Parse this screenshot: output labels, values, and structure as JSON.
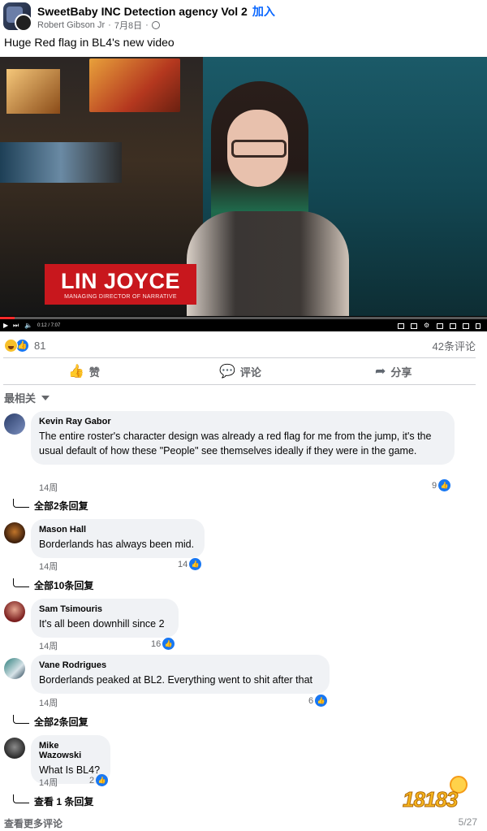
{
  "post": {
    "group_name": "SweetBaby INC Detection agency Vol 2",
    "join_label": "加入",
    "author": "Robert Gibson Jr",
    "date": "7月8日",
    "text": "Huge Red flag in BL4's new video"
  },
  "video": {
    "name_plate": "LIN JOYCE",
    "name_subtitle": "MANAGING DIRECTOR OF NARRATIVE",
    "time": "0:12 / 7:07",
    "progress": 0.03,
    "colors": {
      "progress": "#ff2a2a",
      "plate": "#c8171d"
    }
  },
  "stats": {
    "reaction_count": "81",
    "comment_count": "42条评论"
  },
  "actions": {
    "like": "赞",
    "comment": "评论",
    "share": "分享"
  },
  "sort_label": "最相关",
  "comments": [
    {
      "name": "Kevin Ray Gabor",
      "text": "The entire roster's character design was already a red flag for me from the jump, it's the usual default of how these \"People\" see themselves ideally if they were in the game.",
      "time": "14周",
      "likes": "9",
      "replies": "全部2条回复"
    },
    {
      "name": "Mason Hall",
      "text": "Borderlands has always been mid.",
      "time": "14周",
      "likes": "14",
      "replies": "全部10条回复"
    },
    {
      "name": "Sam Tsimouris",
      "text": "It's all been downhill since 2",
      "time": "14周",
      "likes": "16",
      "replies": ""
    },
    {
      "name": "Vane Rodrigues",
      "text": "Borderlands peaked at BL2. Everything went to shit after that",
      "time": "14周",
      "likes": "6",
      "replies": "全部2条回复"
    },
    {
      "name": "Mike Wazowski",
      "text": "What Is BL4?",
      "time": "14周",
      "likes": "2",
      "replies": "查看 1 条回复"
    }
  ],
  "view_more": "查看更多评论",
  "page_counter": "5/27",
  "watermark": "18183",
  "icons": {
    "group": "group-avatar-icon",
    "globe": "globe-icon",
    "like": "thumbs-up-icon",
    "comment": "speech-bubble-icon",
    "share": "share-arrow-icon",
    "haha": "haha-reaction-icon"
  }
}
